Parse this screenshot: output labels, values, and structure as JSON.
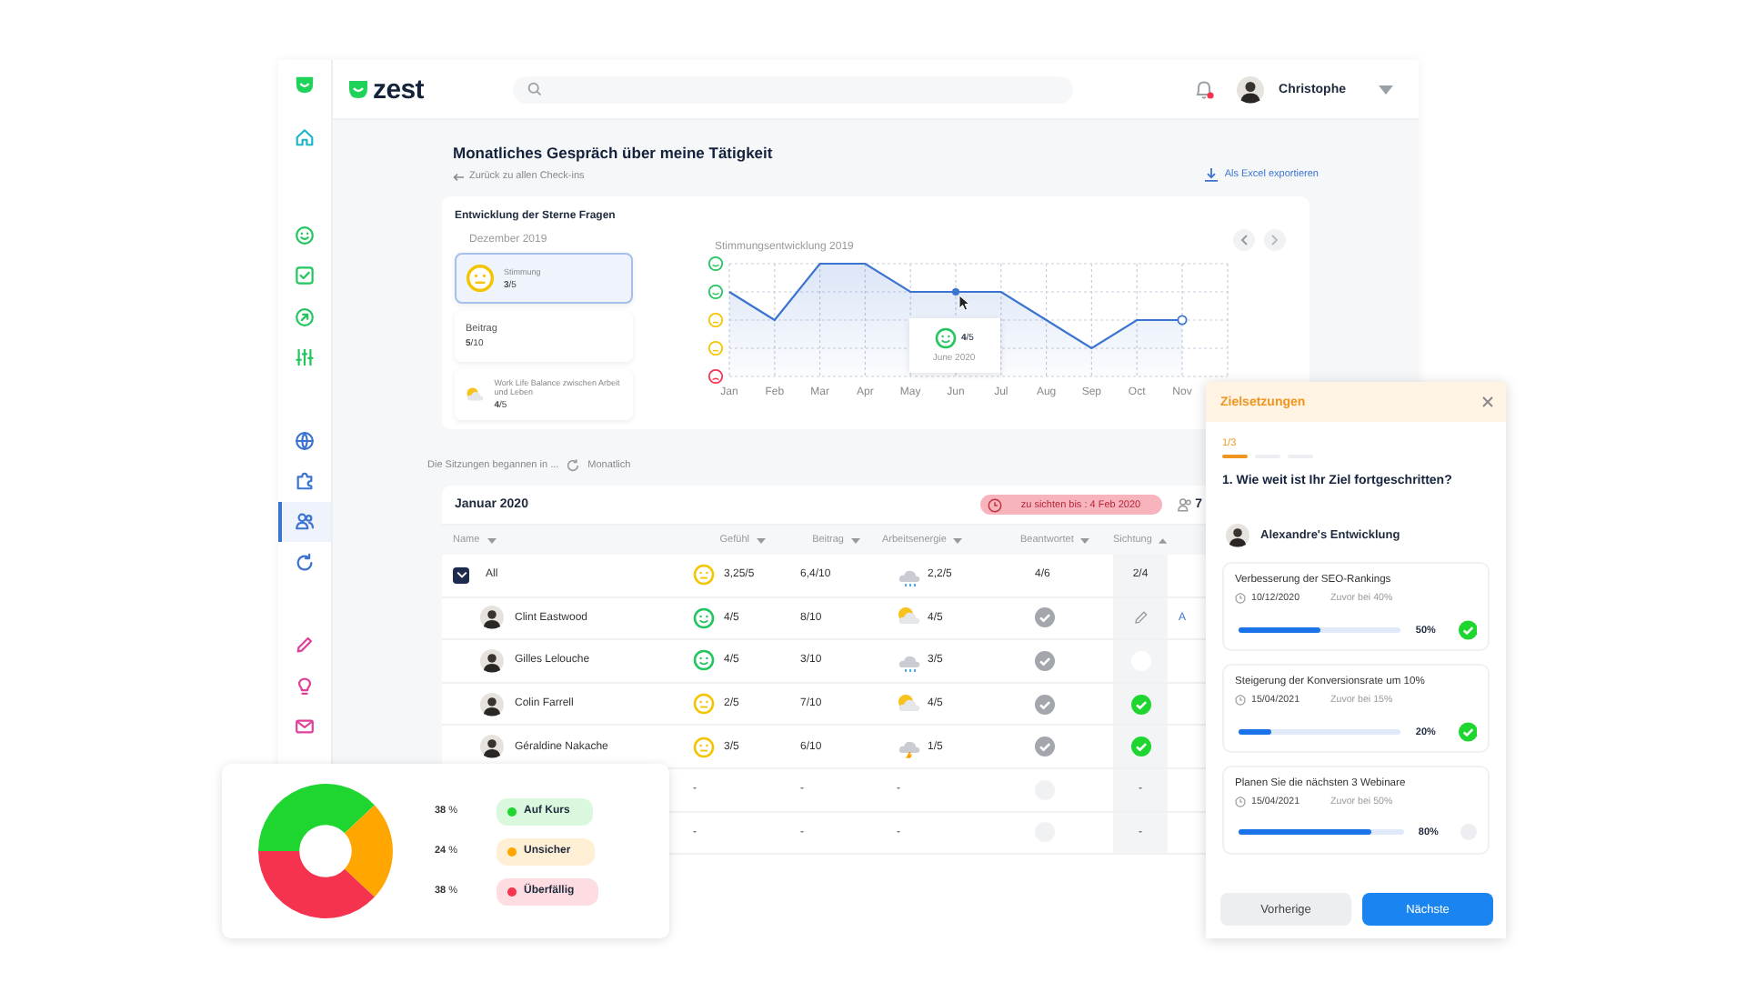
{
  "sidebar": {
    "groups": [
      {
        "items": [
          {
            "selected": false
          }
        ]
      },
      {
        "items": [
          {
            "selected": false
          },
          {
            "selected": false
          },
          {
            "selected": false
          },
          {
            "selected": false
          }
        ]
      },
      {
        "items": [
          {
            "selected": false
          },
          {
            "selected": false
          },
          {
            "selected": true
          },
          {
            "selected": false
          }
        ]
      },
      {
        "items": [
          {
            "selected": false
          },
          {
            "selected": false
          },
          {
            "selected": false
          }
        ]
      }
    ]
  },
  "header": {
    "logo": "zest",
    "notifications": {
      "unread": true
    },
    "user": {
      "name": "Christophe"
    }
  },
  "page": {
    "title": "Monatliches Gespräch über meine Tätigkeit",
    "back_link": "Zurück zu allen Check-ins",
    "export": "Als Excel exportieren"
  },
  "stars_card": {
    "title": "Entwicklung der Sterne Fragen",
    "period": "Dezember 2019",
    "stats": [
      {
        "kind": "face",
        "label": "Stimmung",
        "value": "**3**/5",
        "selected": true
      },
      {
        "kind": "plain",
        "label": "Beitrag",
        "value": "**5**/10",
        "selected": false
      },
      {
        "kind": "weather",
        "label": "Work Life Balance zwischen Arbeit und Leben",
        "value": "**4**/5",
        "selected": false
      }
    ],
    "mood_chart": {
      "title": "Stimmungsentwicklung 2019",
      "months": [
        "Jan",
        "Feb",
        "Mar",
        "Apr",
        "May",
        "Jun",
        "Jul",
        "Aug",
        "Sep",
        "Oct",
        "Nov"
      ],
      "tooltip": {
        "value": "**4**/5",
        "date": "June 2020"
      }
    }
  },
  "sessions": {
    "label": "Die Sitzungen begannen in ...",
    "frequency": "Monatlich"
  },
  "table": {
    "title": "Januar 2020",
    "deadline": "zu sichten bis : 4 Feb 2020",
    "participants": "7",
    "columns": [
      {
        "label": "Name",
        "sorted_ascending": false
      },
      {
        "label": "Gefühl",
        "sorted_ascending": false
      },
      {
        "label": "Beitrag",
        "sorted_ascending": false
      },
      {
        "label": "Arbeitsenergie",
        "sorted_ascending": false
      },
      {
        "label": "Beantwortet",
        "sorted_ascending": false
      },
      {
        "label": "Sichtung",
        "sorted_ascending": true
      }
    ],
    "rows": [
      {
        "kind": "total",
        "checked": true,
        "name": "All",
        "feeling": {
          "kind": "neutral",
          "text": "3,25/5"
        },
        "contribution": "6,4/10",
        "energy": {
          "kind": "rain",
          "text": "2,2/5"
        },
        "answered_count": "4/6",
        "review": {
          "text": "2/4"
        }
      },
      {
        "kind": "person",
        "name": "Clint Eastwood",
        "feeling": {
          "kind": "happy",
          "text": "4/5"
        },
        "contribution": "8/10",
        "energy": {
          "kind": "sun",
          "text": "4/5"
        },
        "answered": true,
        "review": {
          "kind": "edit"
        },
        "action": "A"
      },
      {
        "kind": "person",
        "name": "Gilles Lelouche",
        "feeling": {
          "kind": "happy",
          "text": "4/5"
        },
        "contribution": "3/10",
        "energy": {
          "kind": "rain",
          "text": "3/5"
        },
        "answered": true,
        "review": {
          "kind": "open"
        }
      },
      {
        "kind": "person",
        "name": "Colin Farrell",
        "feeling": {
          "kind": "neutral",
          "text": "2/5"
        },
        "contribution": "7/10",
        "energy": {
          "kind": "sun",
          "text": "4/5"
        },
        "answered": true,
        "review": {
          "kind": "done"
        }
      },
      {
        "kind": "person",
        "name": "Géraldine Nakache",
        "feeling": {
          "kind": "neutral",
          "text": "3/5"
        },
        "contribution": "6/10",
        "energy": {
          "kind": "storm",
          "text": "1/5"
        },
        "answered": true,
        "review": {
          "kind": "done"
        }
      },
      {
        "kind": "empty",
        "feeling": {
          "text": "-"
        },
        "contribution": "-",
        "energy": {
          "text": "-"
        },
        "answered": false,
        "review": {
          "text": "-"
        }
      },
      {
        "kind": "empty",
        "feeling": {
          "text": "-"
        },
        "contribution": "-",
        "energy": {
          "text": "-"
        },
        "answered": false,
        "review": {
          "text": "-"
        }
      }
    ]
  },
  "status_donut": {
    "chart_data": {
      "type": "donut",
      "values": [
        38,
        24,
        38
      ]
    },
    "legend": [
      {
        "value": "**38** %",
        "label": "Auf Kurs",
        "color": "#1fd631"
      },
      {
        "value": "**24** %",
        "label": "Unsicher",
        "color": "#ffa600"
      },
      {
        "value": "**38** %",
        "label": "Überfällig",
        "color": "#f5334f"
      }
    ]
  },
  "goals_panel": {
    "title": "Zielsetzungen",
    "step": "1/3",
    "steps": [
      {
        "selected": true
      },
      {
        "selected": false
      },
      {
        "selected": false
      }
    ],
    "question": "1. Wie weit ist Ihr Ziel fortgeschritten?",
    "owner": "Alexandre's Entwicklung",
    "goals": [
      {
        "title": "Verbesserung der SEO-Rankings",
        "date": "10/12/2020",
        "previous": "Zuvor bei 40%",
        "previous_dimmed": true,
        "level": 0.5,
        "percent": "50%",
        "done": true
      },
      {
        "title": "Steigerung der Konversionsrate um 10%",
        "date": "15/04/2021",
        "previous": "Zuvor bei 15%",
        "previous_dimmed": true,
        "level": 0.2,
        "percent": "20%",
        "done": true
      },
      {
        "title": "Planen Sie die nächsten 3 Webinare",
        "date": "15/04/2021",
        "previous": "Zuvor bei 50%",
        "previous_dimmed": true,
        "level": 0.8,
        "percent": "80%",
        "done": false
      }
    ],
    "buttons": [
      {
        "label": "Vorherige",
        "kind": "secondary"
      },
      {
        "label": "Nächste",
        "kind": "primary"
      }
    ]
  }
}
